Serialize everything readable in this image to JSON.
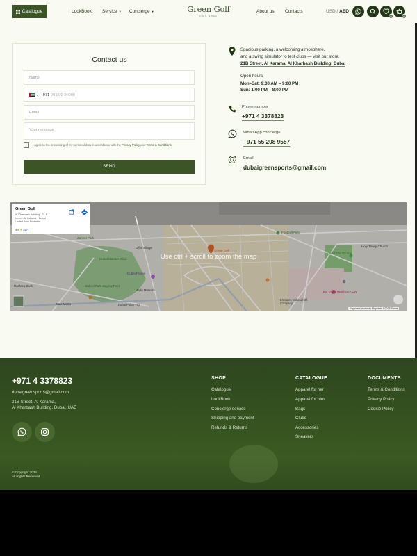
{
  "header": {
    "catalogue_button": "Catalogue",
    "nav": [
      {
        "label": "LookBook",
        "has_dropdown": false
      },
      {
        "label": "Service",
        "has_dropdown": true
      },
      {
        "label": "Concierge",
        "has_dropdown": true
      }
    ],
    "logo": {
      "name": "Green Golf",
      "tagline": "EST. 1983"
    },
    "nav_right": [
      {
        "label": "About us"
      },
      {
        "label": "Contacts"
      }
    ],
    "currency": {
      "inactive": "USD",
      "separator": "/",
      "active": "AED"
    },
    "icons": [
      {
        "name": "whatsapp-icon"
      },
      {
        "name": "search-icon"
      },
      {
        "name": "heart-icon",
        "badge": "0"
      },
      {
        "name": "basket-icon",
        "badge": "0"
      }
    ]
  },
  "contact_form": {
    "title": "Contact us",
    "name_placeholder": "Name",
    "phone_code": "+971",
    "phone_placeholder": "00-000-00000",
    "email_placeholder": "Email",
    "message_placeholder": "Your message",
    "agree_text": "I agree to the processing of my personal data in accordance with the",
    "privacy_link": "Privacy Policy",
    "and_text": "and",
    "terms_link": "Terms & Conditions",
    "send_label": "SEND"
  },
  "store_info": {
    "description_1": "Spacious parking, a welcoming atmosphere,",
    "description_2": "and a swing simulator to test clubs — visit our store.",
    "address": "21B Street, Al Karama, Al Kharbash Building, Dubai",
    "hours_title": "Open hours",
    "hours_weekdays": "Mon–Sat: 9:30 AM – 9:00 PM",
    "hours_sunday": "Sun: 1:00 PM – 8:00 PM",
    "phone_label": "Phone number",
    "phone": "+971 4 3378823",
    "whatsapp_label": "WhatsApp concierge",
    "whatsapp": "+971 55 208 9557",
    "email_label": "Email",
    "email": "dubaigreensports@gmail.com"
  },
  "map": {
    "place_name": "Green Golf",
    "place_address_1": "Al Kharbash Building - 21 B",
    "place_address_2": "street - Al Karama - Dubai -",
    "place_address_3": "United Arab Emirates",
    "rating": "4.6",
    "reviews": "(30)",
    "overlay_text": "Use ctrl + scroll to zoom the map",
    "pin_label": "Green Golf",
    "labels": [
      "Zabeel Park",
      "Dubai Garden Glow",
      "Dubai Frame",
      "Zabeel Park Jogging Track",
      "Mashreq Bank",
      "Football Field",
      "Indian Club Dubai",
      "Holy Trinity Church",
      "Bur Dubai Healthcare City",
      "Emirates National Oil Company",
      "Gifts Village",
      "Dubai Police HQ",
      "Majlis Museum",
      "Maz Metro"
    ],
    "attribution": "Keyboard shortcuts   Map data ©2026   Terms"
  },
  "footer": {
    "phone": "+971 4 3378823",
    "email": "dubaigreensports@gmail.com",
    "address_1": "21B Street, Al Karama,",
    "address_2": "Al Kharbash Building, Dubai, UAE",
    "columns": [
      {
        "title": "SHOP",
        "links": [
          "Catalogue",
          "LookBook",
          "Concierge service",
          "Shipping and payment",
          "Refunds & Returns"
        ]
      },
      {
        "title": "CATALOGUE",
        "links": [
          "Apparel for her",
          "Apparel for him",
          "Bags",
          "Clubs",
          "Accessories",
          "Sneakers"
        ]
      },
      {
        "title": "DOCUMENTS",
        "links": [
          "Terms & Conditions",
          "Privacy Policy",
          "Cookie Policy"
        ]
      }
    ],
    "copyright_1": "© Copyright 2026",
    "copyright_2": "All Rights Reserved"
  },
  "colors": {
    "brand_green": "#3c5527",
    "page_bg": "#f9fbf2",
    "footer_bg": "#34501f"
  }
}
